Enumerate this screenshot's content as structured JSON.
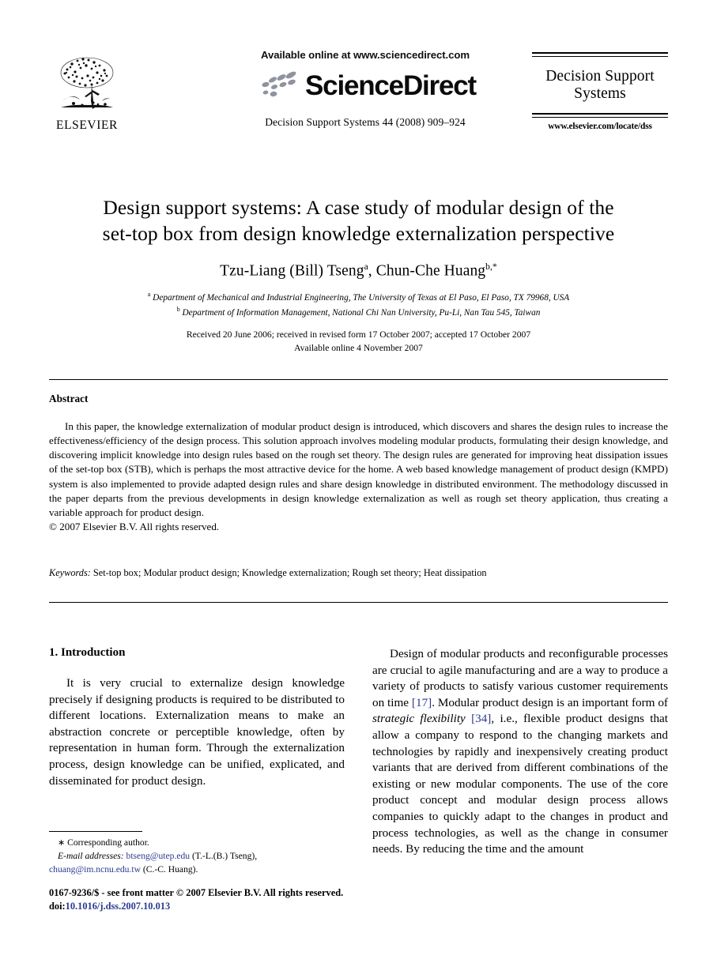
{
  "masthead": {
    "publisher_name": "ELSEVIER",
    "available_online": "Available online at www.sciencedirect.com",
    "sciencedirect_wordmark": "ScienceDirect",
    "journal_reference": "Decision Support Systems 44 (2008) 909–924",
    "journal_box_title_line1": "Decision Support",
    "journal_box_title_line2": "Systems",
    "journal_box_url": "www.elsevier.com/locate/dss"
  },
  "title_block": {
    "title_line1": "Design support systems: A case study of modular design of the",
    "title_line2": "set-top box from design knowledge externalization perspective",
    "author1_name": "Tzu-Liang (Bill) Tseng",
    "author1_mark": "a",
    "author_separator": ", ",
    "author2_name": "Chun-Che Huang",
    "author2_mark": "b,*",
    "affiliation_a_mark": "a",
    "affiliation_a": "Department of Mechanical and Industrial Engineering, The University of Texas at El Paso, El Paso, TX 79968, USA",
    "affiliation_b_mark": "b",
    "affiliation_b": "Department of Information Management, National Chi Nan University, Pu-Li, Nan Tau 545, Taiwan",
    "dates_line1": "Received 20 June 2006; received in revised form 17 October 2007; accepted 17 October 2007",
    "dates_line2": "Available online 4 November 2007"
  },
  "abstract": {
    "heading": "Abstract",
    "body": "In this paper, the knowledge externalization of modular product design is introduced, which discovers and shares the design rules to increase the effectiveness/efficiency of the design process. This solution approach involves modeling modular products, formulating their design knowledge, and discovering implicit knowledge into design rules based on the rough set theory. The design rules are generated for improving heat dissipation issues of the set-top box (STB), which is perhaps the most attractive device for the home. A web based knowledge management of product design (KMPD) system is also implemented to provide adapted design rules and share design knowledge in distributed environment. The methodology discussed in the paper departs from the previous developments in design knowledge externalization as well as rough set theory application, thus creating a variable approach for product design.",
    "copyright": "© 2007 Elsevier B.V. All rights reserved."
  },
  "keywords": {
    "label": "Keywords:",
    "list": "Set-top box; Modular product design; Knowledge externalization; Rough set theory; Heat dissipation"
  },
  "sections": {
    "intro_heading": "1. Introduction",
    "left_paragraph_1": "It is very crucial to externalize design knowledge precisely if designing products is required to be distributed to different locations. Externalization means to make an abstraction concrete or perceptible knowledge, often by representation in human form. Through the externalization process, design knowledge can be unified, explicated, and disseminated for product design.",
    "right_paragraph_1_part1": "Design of modular products and reconfigurable processes are crucial to agile manufacturing and are a way to produce a variety of products to satisfy various customer requirements on time ",
    "right_citation_1": "[17]",
    "right_paragraph_1_part2": ". Modular product design is an important form of ",
    "right_paragraph_1_italic": "strategic flexibility",
    "right_paragraph_1_part3": " ",
    "right_citation_2": "[34]",
    "right_paragraph_1_part4": ", i.e., flexible product designs that allow a company to respond to the changing markets and technologies by rapidly and inexpensively creating product variants that are derived from different combinations of the existing or new modular components. The use of the core product concept and modular design process allows companies to quickly adapt to the changes in product and process technologies, as well as the change in consumer needs. By reducing the time and the amount"
  },
  "footnote": {
    "star": "∗",
    "corresponding_author": "Corresponding author.",
    "email_label": "E-mail addresses:",
    "email1": "btseng@utep.edu",
    "email1_owner": "(T.-L.(B.) Tseng),",
    "email2": "chuang@im.ncnu.edu.tw",
    "email2_owner": "(C.-C. Huang)."
  },
  "imprint": {
    "issn_line": "0167-9236/$ - see front matter © 2007 Elsevier B.V. All rights reserved.",
    "doi_label": "doi:",
    "doi_value": "10.1016/j.dss.2007.10.013"
  },
  "colors": {
    "link": "#2b3a8f",
    "text": "#000000",
    "background": "#ffffff"
  }
}
